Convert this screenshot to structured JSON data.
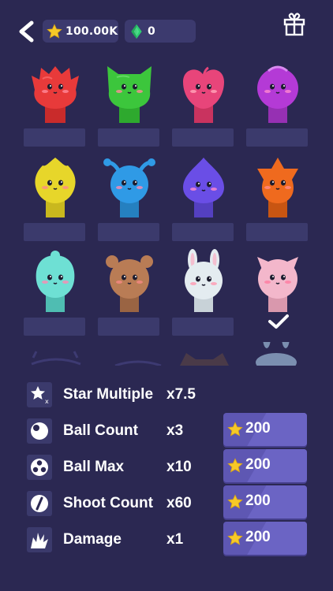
{
  "header": {
    "stars_value": "100.00K",
    "gems_value": "0",
    "icons": {
      "back": "back-chevron-icon",
      "star": "star-icon",
      "gem": "green-gem-icon",
      "gift": "gift-box-icon"
    }
  },
  "characters": [
    {
      "name": "red-blob-character",
      "color": "#e83a3a"
    },
    {
      "name": "green-cat-character",
      "color": "#3cc63c"
    },
    {
      "name": "pink-heart-character",
      "color": "#e8457a"
    },
    {
      "name": "purple-bubble-character",
      "color": "#b43ad6"
    },
    {
      "name": "yellow-flame-character",
      "color": "#e7d62a"
    },
    {
      "name": "blue-antenna-character",
      "color": "#2f9ae6"
    },
    {
      "name": "indigo-spade-character",
      "color": "#6a4ee6"
    },
    {
      "name": "orange-fox-character",
      "color": "#ef6a1e"
    },
    {
      "name": "mint-swirl-character",
      "color": "#6ee0d4"
    },
    {
      "name": "brown-bear-character",
      "color": "#b97c55"
    },
    {
      "name": "white-bunny-character",
      "color": "#e4ecf0"
    },
    {
      "name": "pink-pig-character",
      "color": "#f3b7cb",
      "selected": true
    }
  ],
  "upgrades": [
    {
      "label": "Star Multiple",
      "value": "x7.5",
      "icon": "star-multiplier-icon"
    },
    {
      "label": "Ball Count",
      "value": "x3",
      "icon": "ball-icon",
      "price": "200"
    },
    {
      "label": "Ball Max",
      "value": "x10",
      "icon": "ball-max-icon",
      "price": "200"
    },
    {
      "label": "Shoot Count",
      "value": "x60",
      "icon": "shoot-slash-icon",
      "price": "200"
    },
    {
      "label": "Damage",
      "value": "x1",
      "icon": "damage-burst-icon",
      "price": "200"
    }
  ],
  "colors": {
    "background": "#2b2852",
    "panel": "#3b3a6c",
    "button": "#5e57b3",
    "star": "#f6c928",
    "gem": "#2ecc71"
  }
}
